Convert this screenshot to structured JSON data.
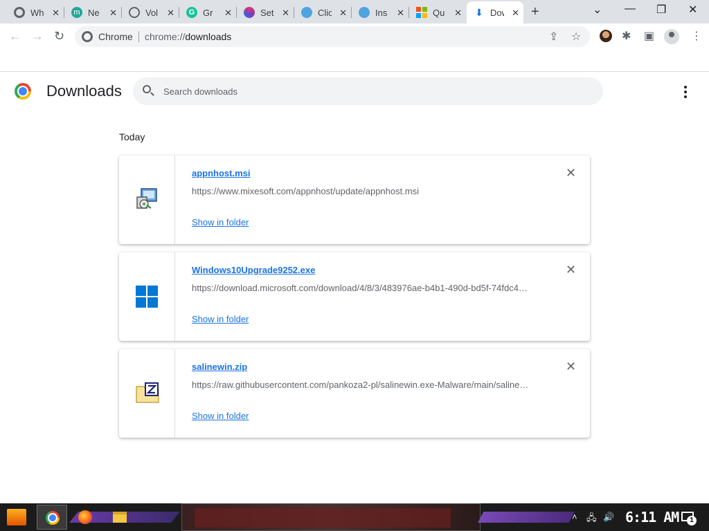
{
  "tabs": [
    {
      "title": "Wh",
      "icon": "chrome-icon"
    },
    {
      "title": "Ne",
      "icon": "m-site-icon"
    },
    {
      "title": "Vol",
      "icon": "circle-icon"
    },
    {
      "title": "Gr",
      "icon": "g-site-icon"
    },
    {
      "title": "Set",
      "icon": "settings-site-icon"
    },
    {
      "title": "Clic",
      "icon": "cursor-site-icon"
    },
    {
      "title": "Ins",
      "icon": "cursor-site-icon"
    },
    {
      "title": "Qu",
      "icon": "microsoft-icon"
    },
    {
      "title": "Dow",
      "icon": "download-icon",
      "active": true
    }
  ],
  "omnibox": {
    "chip": "Chrome",
    "url_scheme": "chrome://",
    "url_path": "downloads"
  },
  "page": {
    "title": "Downloads",
    "search_placeholder": "Search downloads",
    "date_group": "Today"
  },
  "downloads": [
    {
      "filename": "appnhost.msi",
      "url": "https://www.mixesoft.com/appnhost/update/appnhost.msi",
      "action": "Show in folder",
      "icon": "installer-icon"
    },
    {
      "filename": "Windows10Upgrade9252.exe",
      "url": "https://download.microsoft.com/download/4/8/3/483976ae-b4b1-490d-bd5f-74fdc4…",
      "action": "Show in folder",
      "icon": "windows-logo-icon"
    },
    {
      "filename": "salinewin.zip",
      "url": "https://raw.githubusercontent.com/pankoza2-pl/salinewin.exe-Malware/main/saline…",
      "action": "Show in folder",
      "icon": "zip-archive-icon"
    }
  ],
  "taskbar": {
    "clock": "6:11 AM",
    "notification_count": "1"
  },
  "colors": {
    "link": "#1a73e8",
    "tabstrip": "#dee1e6",
    "omnibox": "#f1f3f4"
  }
}
